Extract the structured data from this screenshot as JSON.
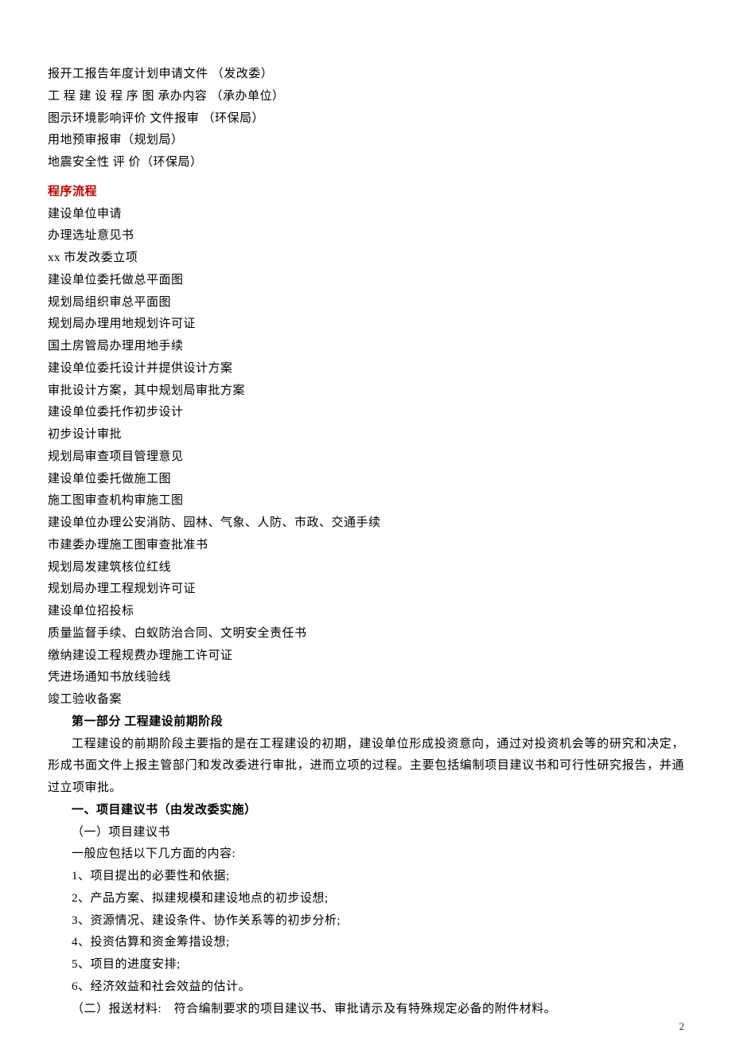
{
  "intro_lines": [
    "报开工报告年度计划申请文件 （发改委）",
    "工 程 建 设 程 序 图 承办内容 （承办单位）",
    "图示环境影响评价 文件报审 （环保局）",
    "用地预审报审（规划局）",
    "地震安全性 评 价（环保局）"
  ],
  "procedure_heading": "程序流程",
  "procedure_steps": [
    "建设单位申请",
    "办理选址意见书",
    "xx 市发改委立项",
    "建设单位委托做总平面图",
    "规划局组织审总平面图",
    "规划局办理用地规划许可证",
    "国土房管局办理用地手续",
    "建设单位委托设计并提供设计方案",
    "审批设计方案，其中规划局审批方案",
    "建设单位委托作初步设计",
    "初步设计审批",
    "规划局审查项目管理意见",
    "建设单位委托做施工图",
    "施工图审查机构审施工图",
    "建设单位办理公安消防、园林、气象、人防、市政、交通手续",
    "市建委办理施工图审查批准书",
    "规划局发建筑核位红线",
    "规划局办理工程规划许可证",
    "建设单位招投标",
    "质量监督手续、白蚁防治合同、文明安全责任书",
    "缴纳建设工程规费办理施工许可证",
    "凭进场通知书放线验线",
    "竣工验收备案"
  ],
  "part1_heading": "第一部分 工程建设前期阶段",
  "part1_paragraph": "工程建设的前期阶段主要指的是在工程建设的初期，建设单位形成投资意向，通过对投资机会等的研究和决定，形成书面文件上报主管部门和发改委进行审批，进而立项的过程。主要包括编制项目建议书和可行性研究报告，并通过立项审批。",
  "section1_heading": "一、项目建议书（由发改委实施）",
  "section1_items": [
    "（一）项目建议书",
    "一般应包括以下几方面的内容:",
    "1、项目提出的必要性和依据;",
    "2、产品方案、拟建规模和建设地点的初步设想;",
    "3、资源情况、建设条件、协作关系等的初步分析;",
    "4、投资估算和资金筹措设想;",
    "5、项目的进度安排;",
    "6、经济效益和社会效益的估计。",
    "（二）报送材料:　符合编制要求的项目建议书、审批请示及有特殊规定必备的附件材料。"
  ],
  "page_number": "2"
}
